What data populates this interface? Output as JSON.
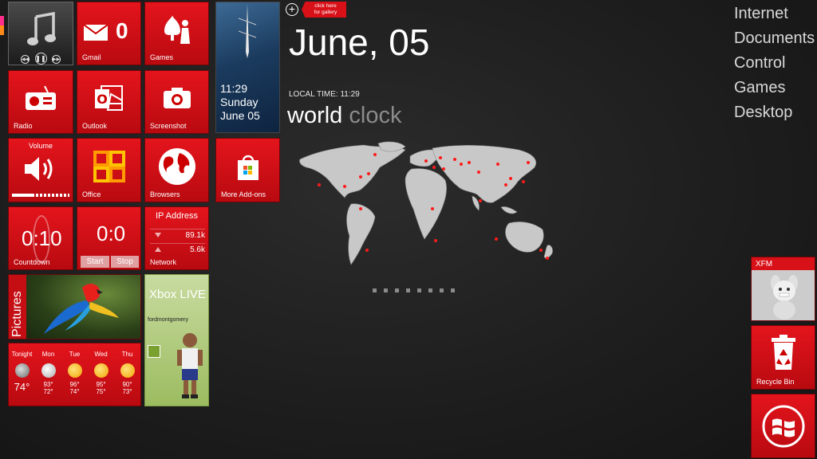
{
  "tiles": {
    "gmail": {
      "label": "Gmail",
      "count": "0"
    },
    "games": {
      "label": "Games"
    },
    "radio": {
      "label": "Radio"
    },
    "outlook": {
      "label": "Outlook"
    },
    "screenshot": {
      "label": "Screenshot"
    },
    "volume": {
      "label": "Volume",
      "level": 0.35
    },
    "office": {
      "label": "Office"
    },
    "browsers": {
      "label": "Browsers"
    },
    "addons": {
      "label": "More Add-ons"
    },
    "countdown": {
      "label": "Countdown",
      "value": "0:10"
    },
    "stopwatch": {
      "value": "0:0",
      "start": "Start",
      "stop": "Stop"
    },
    "network": {
      "title": "IP Address",
      "download": "89.1k",
      "upload": "5.6k",
      "label": "Network"
    },
    "pictures": {
      "label": "Pictures"
    },
    "xbox": {
      "title": "Xbox LIVE",
      "gamertag": "fordmontgomery"
    },
    "photo": {
      "time": "11:29",
      "day": "Sunday",
      "date": "June 05"
    },
    "xfm": {
      "label": "XFM"
    },
    "recycle": {
      "label": "Recycle Bin"
    }
  },
  "weather": [
    {
      "day": "Tonight",
      "icon": "moon-icon",
      "temp": "74°"
    },
    {
      "day": "Mon",
      "icon": "storm-icon",
      "hi": "93°",
      "lo": "72°"
    },
    {
      "day": "Tue",
      "icon": "sun-icon",
      "hi": "96°",
      "lo": "74°"
    },
    {
      "day": "Wed",
      "icon": "partly-cloudy-icon",
      "hi": "95°",
      "lo": "75°"
    },
    {
      "day": "Thu",
      "icon": "partly-cloudy-icon",
      "hi": "90°",
      "lo": "73°"
    }
  ],
  "gallery": {
    "line1": "click here",
    "line2": "for gallery"
  },
  "clock": {
    "date": "June, 05",
    "local_time_label": "LOCAL TIME: 11:29",
    "title_a": "world",
    "title_b": "clock"
  },
  "menu": [
    "Internet",
    "Documents",
    "Control",
    "Games",
    "Desktop"
  ],
  "colors": {
    "accent": "#e4141c",
    "menu_text": "#d8d8d8"
  }
}
